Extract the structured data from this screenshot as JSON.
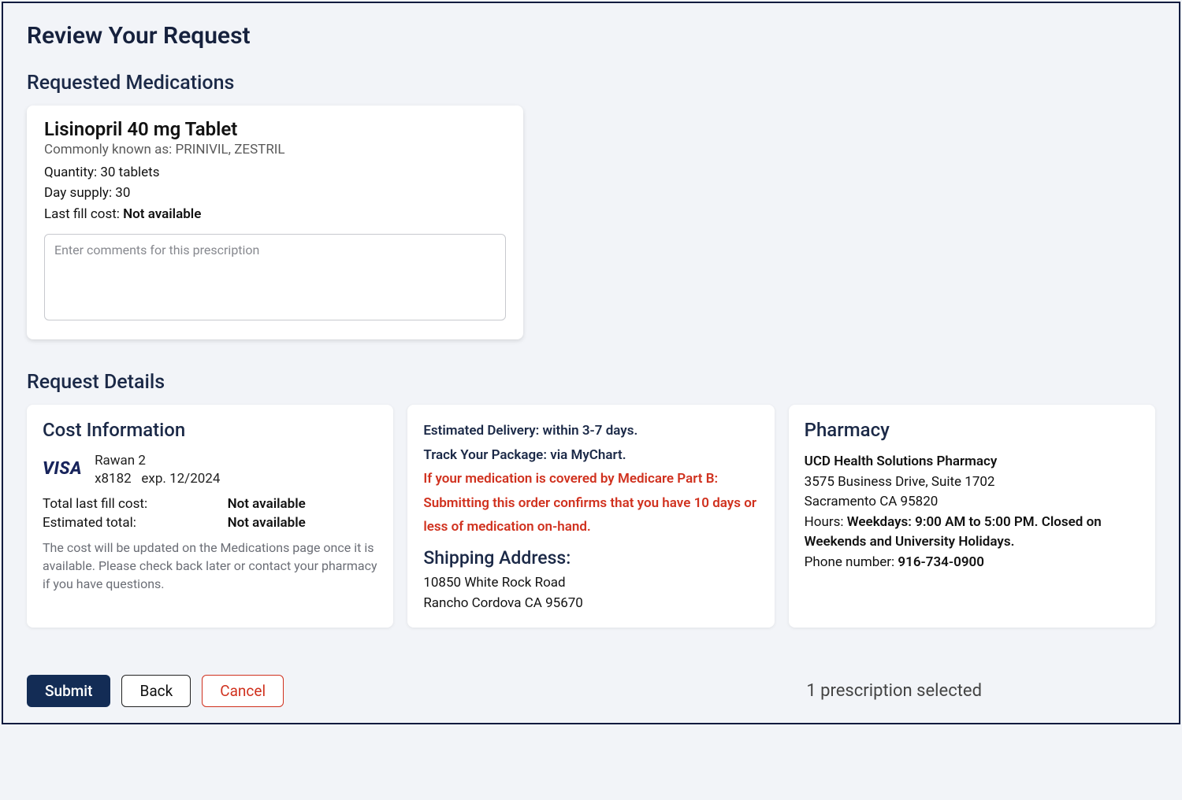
{
  "page": {
    "title": "Review Your Request"
  },
  "medications": {
    "section_title": "Requested Medications",
    "items": [
      {
        "name": "Lisinopril 40 mg Tablet",
        "alias_label": "Commonly known as:",
        "alias_value": "PRINIVIL, ZESTRIL",
        "quantity_label": "Quantity:",
        "quantity_value": "30 tablets",
        "day_supply_label": "Day supply:",
        "day_supply_value": "30",
        "last_fill_label": "Last fill cost:",
        "last_fill_value": "Not available",
        "comments_placeholder": "Enter comments for this prescription"
      }
    ]
  },
  "details": {
    "section_title": "Request Details",
    "cost": {
      "title": "Cost Information",
      "card_brand": "VISA",
      "card_name": "Rawan 2",
      "card_last4": "x8182",
      "card_exp_label": "exp.",
      "card_exp": "12/2024",
      "total_last_fill_label": "Total last fill cost:",
      "total_last_fill_value": "Not available",
      "estimated_total_label": "Estimated total:",
      "estimated_total_value": "Not available",
      "note": "The cost will be updated on the Medications page once it is available. Please check back later or contact your pharmacy if you have questions."
    },
    "delivery": {
      "estimated_label": "Estimated Delivery:",
      "estimated_value": "within 3-7 days.",
      "track_label": "Track Your Package:",
      "track_value": "via MyChart.",
      "warning": "If your medication is covered by Medicare Part B: Submitting this order confirms that you have 10 days or less of medication on-hand.",
      "shipping_title": "Shipping Address:",
      "address_line1": "10850 White Rock Road",
      "address_line2": "Rancho Cordova CA 95670"
    },
    "pharmacy": {
      "title": "Pharmacy",
      "name": "UCD Health Solutions Pharmacy",
      "address_line1": "3575 Business Drive, Suite 1702",
      "address_line2": "Sacramento CA 95820",
      "hours_label": "Hours:",
      "hours_value": "Weekdays: 9:00 AM to 5:00 PM. Closed on Weekends and University Holidays.",
      "phone_label": "Phone number:",
      "phone_value": "916-734-0900"
    }
  },
  "footer": {
    "submit": "Submit",
    "back": "Back",
    "cancel": "Cancel",
    "status": "1 prescription selected"
  }
}
